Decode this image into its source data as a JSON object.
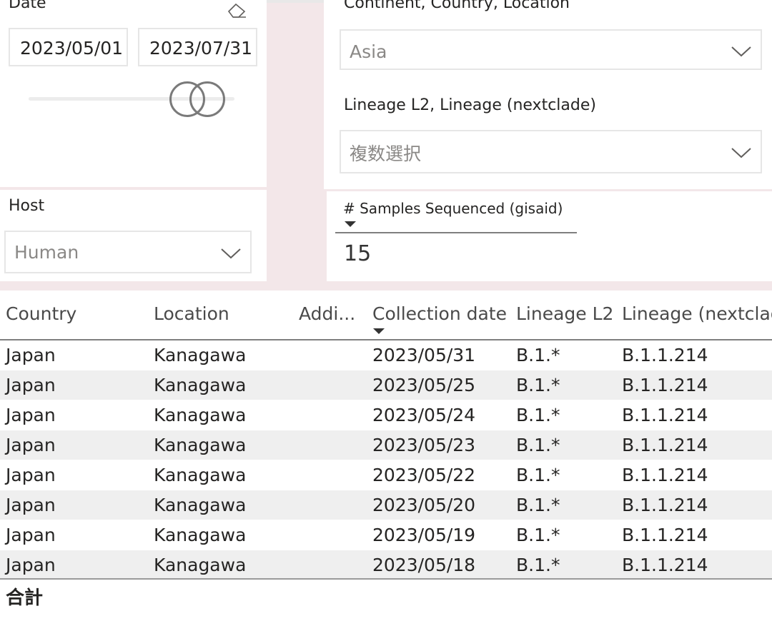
{
  "date_slicer": {
    "title": "Date",
    "start": "2023/05/01",
    "end": "2023/07/31"
  },
  "host_slicer": {
    "title": "Host",
    "value": "Human"
  },
  "location_slicer": {
    "title": "Continent, Country, Location",
    "value": "Asia"
  },
  "lineage_slicer": {
    "title": "Lineage L2, Lineage (nextclade)",
    "value": "複数選択"
  },
  "metric_card": {
    "title": "# Samples Sequenced (gisaid)",
    "value": "15"
  },
  "table": {
    "columns": [
      "Country",
      "Location",
      "Addi...",
      "Collection date",
      "Lineage L2",
      "Lineage (nextclade"
    ],
    "rows": [
      [
        "Japan",
        "Kanagawa",
        "",
        "2023/05/31",
        "B.1.*",
        "B.1.1.214"
      ],
      [
        "Japan",
        "Kanagawa",
        "",
        "2023/05/25",
        "B.1.*",
        "B.1.1.214"
      ],
      [
        "Japan",
        "Kanagawa",
        "",
        "2023/05/24",
        "B.1.*",
        "B.1.1.214"
      ],
      [
        "Japan",
        "Kanagawa",
        "",
        "2023/05/23",
        "B.1.*",
        "B.1.1.214"
      ],
      [
        "Japan",
        "Kanagawa",
        "",
        "2023/05/22",
        "B.1.*",
        "B.1.1.214"
      ],
      [
        "Japan",
        "Kanagawa",
        "",
        "2023/05/20",
        "B.1.*",
        "B.1.1.214"
      ],
      [
        "Japan",
        "Kanagawa",
        "",
        "2023/05/19",
        "B.1.*",
        "B.1.1.214"
      ],
      [
        "Japan",
        "Kanagawa",
        "",
        "2023/05/18",
        "B.1.*",
        "B.1.1.214"
      ]
    ],
    "total_label": "合計"
  },
  "icons": {
    "eraser": "eraser-icon",
    "chevron": "chevron-down-icon",
    "sort": "sort-descending-icon"
  },
  "colors": {
    "background_band": "#f3e7e9",
    "row_alt": "#efefef"
  }
}
